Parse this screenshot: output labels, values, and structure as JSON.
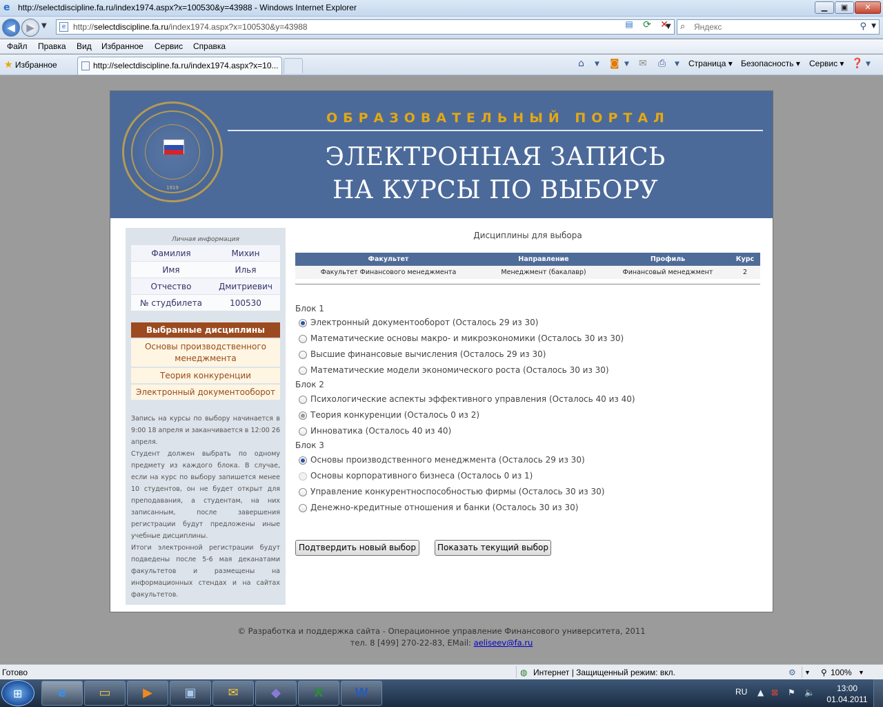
{
  "window": {
    "title": "http://selectdiscipline.fa.ru/index1974.aspx?x=100530&y=43988 - Windows Internet Explorer",
    "min_glyph": "▁",
    "max_glyph": "▣",
    "close_glyph": "✕"
  },
  "address": {
    "url_prefix": "http://",
    "url_host": "selectdiscipline.fa.ru",
    "url_path": "/index1974.aspx?x=100530&y=43988",
    "search_placeholder": "Яндекс"
  },
  "menu": [
    "Файл",
    "Правка",
    "Вид",
    "Избранное",
    "Сервис",
    "Справка"
  ],
  "favbar": {
    "favorites_label": "Избранное",
    "tab_label": "http://selectdiscipline.fa.ru/index1974.aspx?x=10...",
    "commands": [
      "Страница ▾",
      "Безопасность ▾",
      "Сервис ▾"
    ]
  },
  "header": {
    "portal_title": "ОБРАЗОВАТЕЛЬНЫЙ ПОРТАЛ",
    "title_line1": "ЭЛЕКТРОННАЯ ЗАПИСЬ",
    "title_line2": "НА КУРСЫ ПО ВЫБОРУ",
    "seal_year": "1919"
  },
  "personal": {
    "caption": "Личная информация",
    "rows": [
      {
        "key": "Фамилия",
        "value": "Михин"
      },
      {
        "key": "Имя",
        "value": "Илья"
      },
      {
        "key": "Отчество",
        "value": "Дмитриевич"
      },
      {
        "key": "№ студбилета",
        "value": "100530"
      }
    ]
  },
  "selected": {
    "heading": "Выбранные дисциплины",
    "items": [
      "Основы производственного менеджмента",
      "Теория конкуренции",
      "Электронный документооборот"
    ]
  },
  "info_paragraphs": [
    "Запись на курсы по выбору начинается в 9:00 18 апреля и заканчивается в 12:00 26 апреля.",
    "Студент должен выбрать по одному предмету из каждого блока. В случае, если на курс по выбору запишется менее 10 студентов, он не будет открыт для преподавания, а студентам, на них записанным, после завершения регистрации будут предложены иные учебные дисциплины.",
    "Итоги электронной регистрации будут подведены после 5-6 мая деканатами факультетов и размещены на информационных стендах и на сайтах факультетов."
  ],
  "content": {
    "title": "Дисциплины для выбора",
    "table": {
      "headers": [
        "Факультет",
        "Направление",
        "Профиль",
        "Курс"
      ],
      "row": [
        "Факультет Финансового менеджмента",
        "Менеджмент (бакалавр)",
        "Финансовый менеджмент",
        "2"
      ]
    },
    "blocks": [
      {
        "label": "Блок 1",
        "options": [
          {
            "text": "Электронный документооборот (Осталось 29 из 30)",
            "state": "checked"
          },
          {
            "text": "Математические основы макро- и микроэкономики (Осталось 30 из 30)",
            "state": "normal"
          },
          {
            "text": "Высшие финансовые вычисления (Осталось 29 из 30)",
            "state": "normal"
          },
          {
            "text": "Математические модели экономического роста (Осталось 30 из 30)",
            "state": "normal"
          }
        ]
      },
      {
        "label": "Блок 2",
        "options": [
          {
            "text": "Психологические аспекты эффективного управления (Осталось 40 из 40)",
            "state": "normal"
          },
          {
            "text": "Теория конкуренции (Осталось 0 из 2)",
            "state": "checked-disabled"
          },
          {
            "text": "Инноватика (Осталось 40 из 40)",
            "state": "normal"
          }
        ]
      },
      {
        "label": "Блок 3",
        "options": [
          {
            "text": "Основы производственного менеджмента (Осталось 29 из 30)",
            "state": "checked"
          },
          {
            "text": "Основы корпоративного бизнеса (Осталось 0 из 1)",
            "state": "disabled"
          },
          {
            "text": "Управление конкурентноспособностью фирмы (Осталось 30 из 30)",
            "state": "normal"
          },
          {
            "text": "Денежно-кредитные отношения и банки (Осталось 30 из 30)",
            "state": "normal"
          }
        ]
      }
    ],
    "confirm_button": "Подтвердить новый выбор",
    "show_button": "Показать текущий выбор"
  },
  "footer": {
    "line1": "© Разработка и поддержка сайта - Операционное управление Финансового университета, 2011",
    "line2_prefix": "тел. 8 [499] 270-22-83, EMail: ",
    "email": "aeliseev@fa.ru"
  },
  "statusbar": {
    "status": "Готово",
    "zone": "Интернет | Защищенный режим: вкл.",
    "zoom": "100%"
  },
  "taskbar": {
    "lang": "RU",
    "time": "13:00",
    "date": "01.04.2011"
  },
  "colors": {
    "header_bg": "#4b6a9a",
    "portal_gold": "#e3a814",
    "selected_head": "#9c4a1f",
    "table_head": "#4f6c98"
  }
}
